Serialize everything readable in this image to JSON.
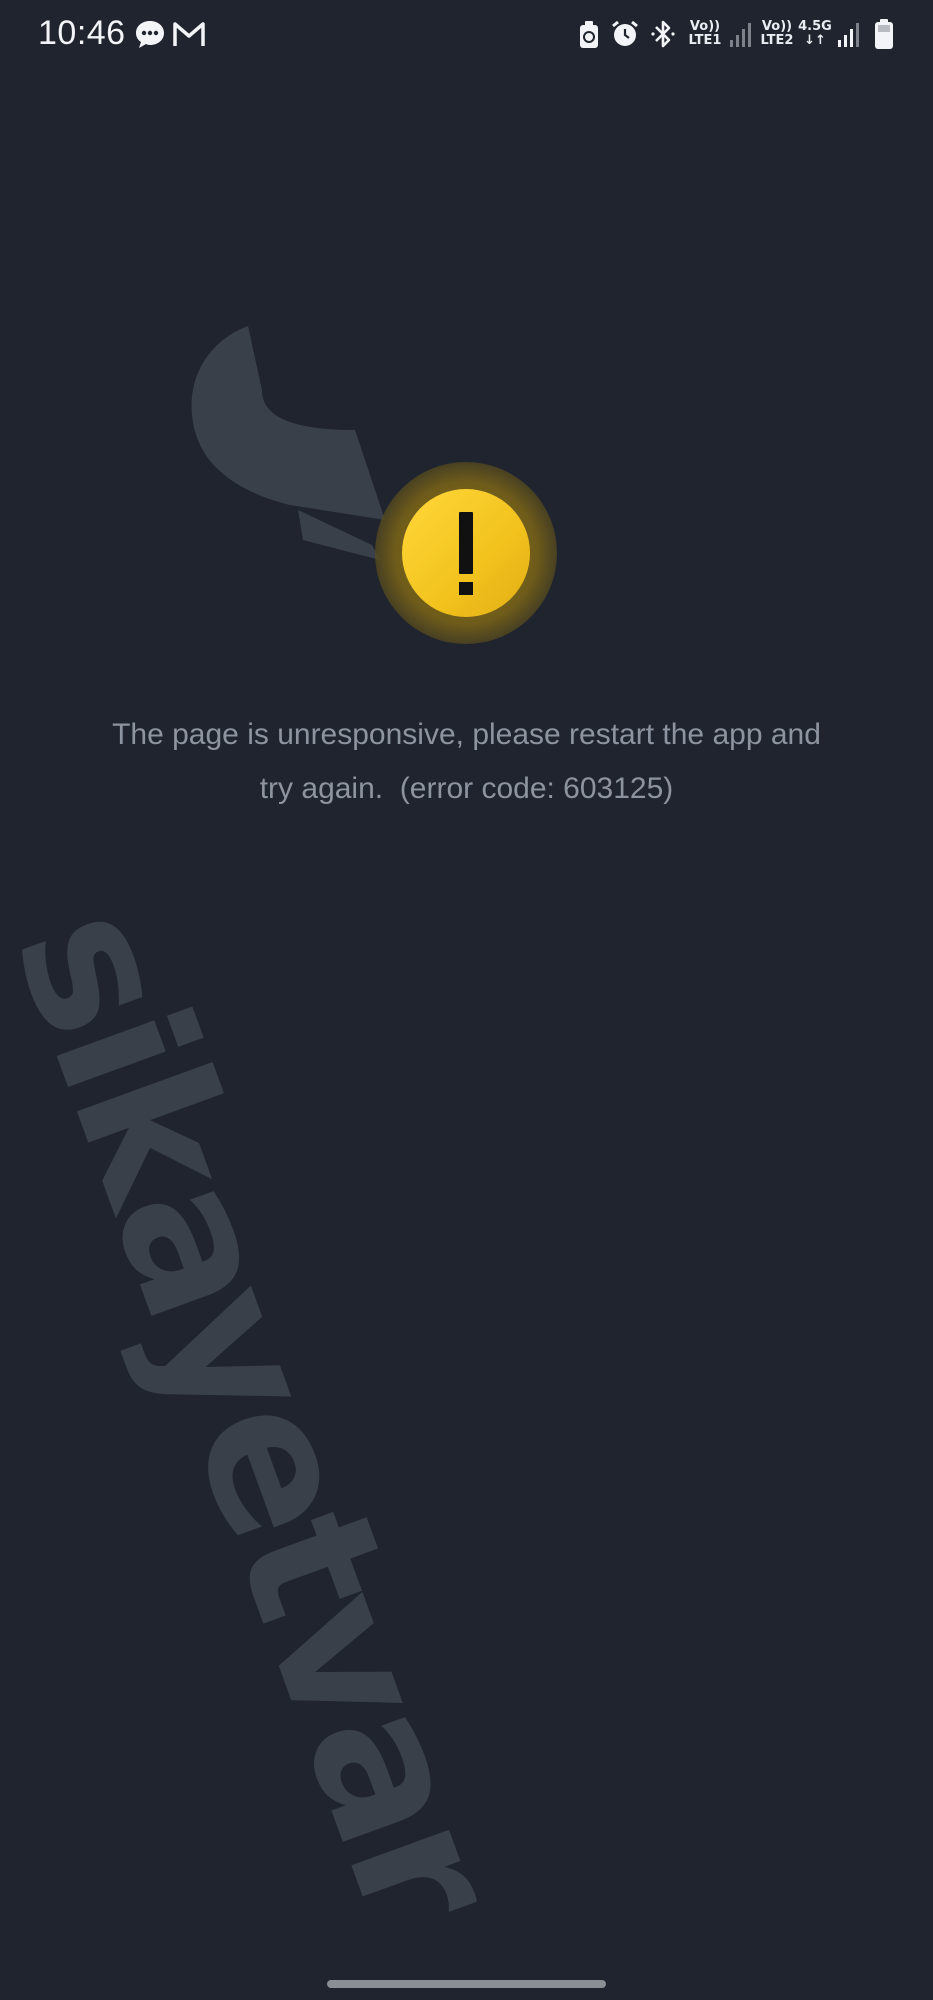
{
  "status_bar": {
    "time": "10:46",
    "sim1_label_top": "Vo))",
    "sim1_label_bottom": "LTE1",
    "sim2_label_top": "Vo))",
    "sim2_label_bottom": "LTE2",
    "network_type": "4.5G",
    "network_arrows": "↓↑",
    "icons": [
      "message-icon",
      "gmail-icon",
      "battery-saver-icon",
      "alarm-icon",
      "bluetooth-icon",
      "signal-icon",
      "signal-icon",
      "battery-icon"
    ]
  },
  "error": {
    "message_line1": "The page is unresponsive, please restart the app and",
    "message_line2": "try again.  (error code: 603125)",
    "icon": "warning-icon"
  },
  "watermark": {
    "text": "sikayetvar"
  },
  "colors": {
    "background": "#1f242e",
    "warning": "#f2c21d",
    "message_text": "#8e949f",
    "watermark": "#3a4049"
  }
}
